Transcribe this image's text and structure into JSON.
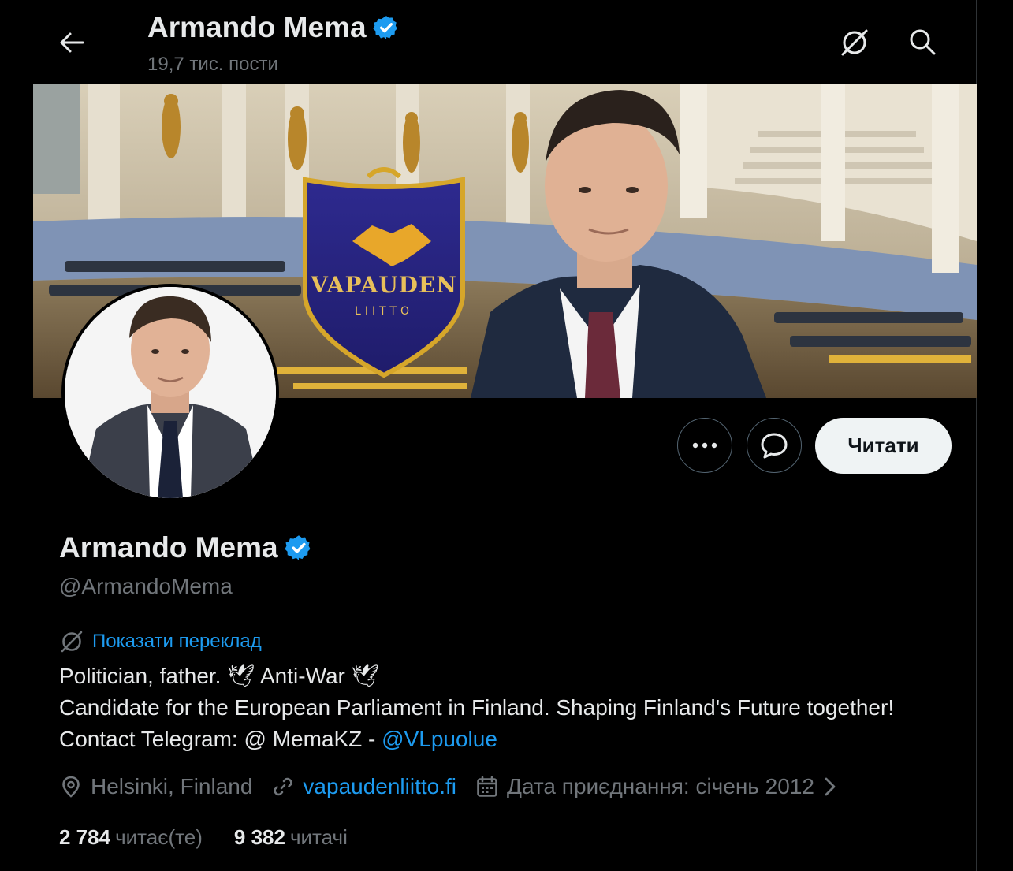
{
  "header": {
    "name": "Armando Mema",
    "posts": "19,7 тис. пости"
  },
  "banner": {
    "shield_title": "VAPAUDEN",
    "shield_subtitle": "LIITTO"
  },
  "profile": {
    "name": "Armando Mema",
    "handle": "@ArmandoMema",
    "translate_label": "Показати переклад",
    "bio_line1": "Politician, father. 🕊 Anti-War 🕊",
    "bio_line2_a": "Candidate for the European Parliament in Finland. Shaping Finland's Future together! Contact Telegram: @ MemaKZ - ",
    "bio_mention": "@VLpuolue",
    "location": "Helsinki, Finland",
    "website": "vapaudenliitto.fi",
    "joined": "Дата приєднання: січень 2012"
  },
  "actions": {
    "follow_label": "Читати"
  },
  "stats": {
    "following_count": "2 784",
    "following_label": "читає(те)",
    "followers_count": "9 382",
    "followers_label": "читачі"
  },
  "colors": {
    "background": "#000000",
    "text": "#e7e9ea",
    "secondary": "#71767b",
    "accent": "#1d9bf0"
  }
}
